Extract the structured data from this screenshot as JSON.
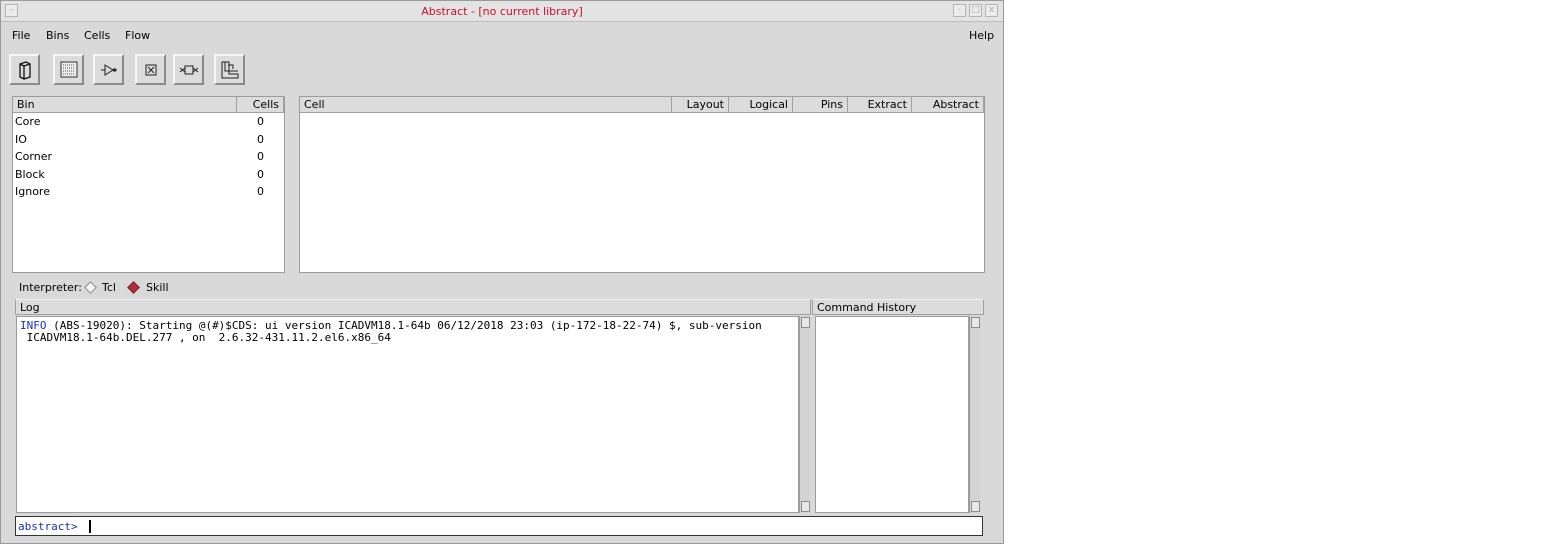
{
  "window": {
    "title": "Abstract - [no current library]"
  },
  "menubar": {
    "items": [
      "File",
      "Bins",
      "Cells",
      "Flow"
    ],
    "help": "Help"
  },
  "toolbar": {
    "tools": [
      "library-icon",
      "bins-icon",
      "logic-gate-icon",
      "pin-box-icon",
      "cell-crossed-icon",
      "layout-icon"
    ]
  },
  "bins": {
    "headers": {
      "bin": "Bin",
      "cells": "Cells"
    },
    "rows": [
      {
        "name": "Core",
        "count": "0"
      },
      {
        "name": "IO",
        "count": "0"
      },
      {
        "name": "Corner",
        "count": "0"
      },
      {
        "name": "Block",
        "count": "0"
      },
      {
        "name": "Ignore",
        "count": "0"
      }
    ]
  },
  "cells": {
    "headers": [
      "Cell",
      "Layout",
      "Logical",
      "Pins",
      "Extract",
      "Abstract"
    ]
  },
  "interpreter": {
    "label": "Interpreter:",
    "options": [
      "Tcl",
      "Skill"
    ],
    "selected": "Skill"
  },
  "log": {
    "label": "Log",
    "lines": [
      {
        "tag": "INFO",
        "text": " (ABS-19020): Starting @(#)$CDS: ui version ICADVM18.1-64b 06/12/2018 23:03 (ip-172-18-22-74) $, sub-version"
      },
      {
        "tag": "",
        "text": " ICADVM18.1-64b.DEL.277 , on  2.6.32-431.11.2.el6.x86_64"
      }
    ]
  },
  "history": {
    "label": "Command History"
  },
  "prompt": {
    "text": "abstract>"
  },
  "colors": {
    "title_red": "#c8102e",
    "info_blue": "#1a2fc8",
    "radio_selected": "#b0303a"
  }
}
